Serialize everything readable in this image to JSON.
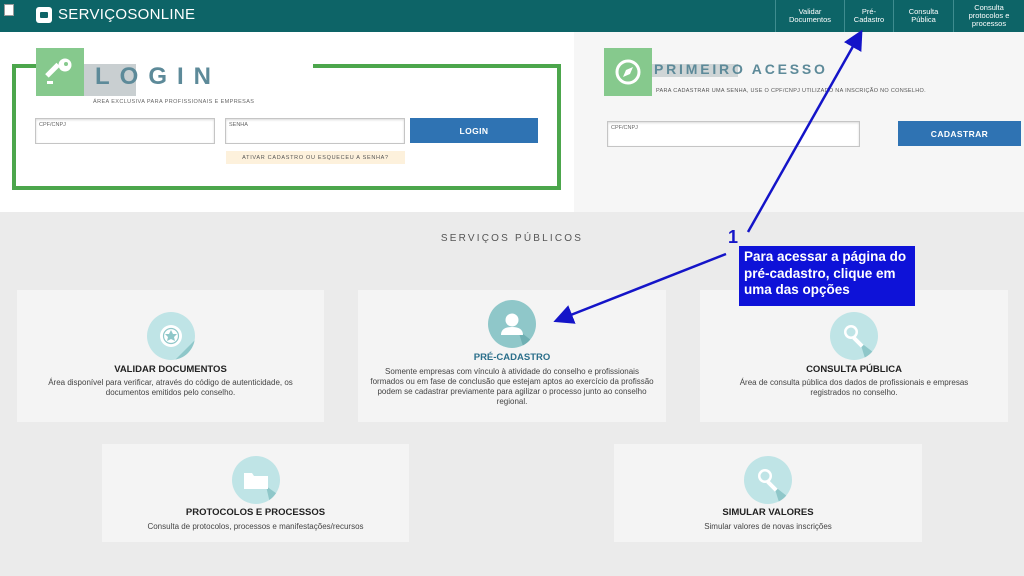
{
  "header": {
    "brand": "SERVIÇOSONLINE",
    "nav": [
      "Validar Documentos",
      "Pré-Cadastro",
      "Consulta Pública",
      "Consulta protocolos e processos"
    ]
  },
  "login": {
    "title": "LOGIN",
    "subtitle": "ÁREA EXCLUSIVA PARA PROFISSIONAIS E EMPRESAS",
    "cpf_placeholder": "CPF/CNPJ",
    "password_placeholder": "SENHA",
    "button": "LOGIN",
    "forgot": "ATIVAR CADASTRO OU ESQUECEU A SENHA?"
  },
  "first_access": {
    "title": "PRIMEIRO ACESSO",
    "subtitle": "PARA CADASTRAR UMA SENHA, USE O CPF/CNPJ UTILIZADO NA INSCRIÇÃO NO CONSELHO.",
    "cpf_placeholder": "CPF/CNPJ",
    "button": "CADASTRAR"
  },
  "services": {
    "title": "SERVIÇOS PÚBLICOS",
    "cards": [
      {
        "title": "VALIDAR DOCUMENTOS",
        "desc": "Área disponível para verificar, através do código de autenticidade, os documentos emitidos pelo conselho."
      },
      {
        "title": "PRÉ-CADASTRO",
        "desc": "Somente empresas com vínculo à atividade do conselho e profissionais formados ou em fase de conclusão que estejam aptos ao exercício da profissão podem se cadastrar previamente para agilizar o processo junto ao conselho regional."
      },
      {
        "title": "CONSULTA PÚBLICA",
        "desc": "Área de consulta pública dos dados de profissionais e empresas registrados no conselho."
      },
      {
        "title": "PROTOCOLOS E PROCESSOS",
        "desc": "Consulta de protocolos, processos e manifestações/recursos"
      },
      {
        "title": "SIMULAR VALORES",
        "desc": "Simular valores de novas inscrições"
      }
    ]
  },
  "annotation": {
    "number": "1",
    "text": "Para  acessar a  página do pré-cadastro, clique em uma das opções"
  },
  "colors": {
    "topbar": "#0d6467",
    "accent_green": "#4ca64c",
    "button_blue": "#2f73b3",
    "annotation_blue": "#0e12d8"
  }
}
